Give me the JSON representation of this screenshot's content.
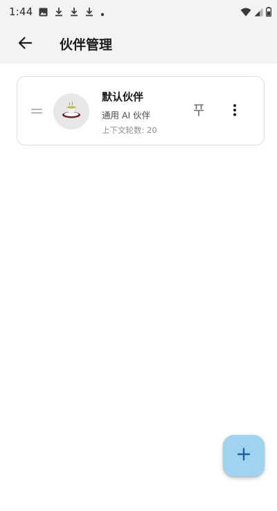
{
  "status_bar": {
    "time": "1:44",
    "left_icons": [
      "image-icon",
      "download-icon",
      "download-icon",
      "download-icon",
      "dot-icon"
    ],
    "right_icons": [
      "wifi-icon",
      "signal-icon",
      "battery-icon"
    ]
  },
  "app_bar": {
    "back_icon": "arrow-left-icon",
    "title": "伙伴管理"
  },
  "partners": [
    {
      "name": "默认伙伴",
      "description": "通用 AI 伙伴",
      "context": "上下文轮数: 20",
      "avatar_icon": "tea-cup-icon",
      "pin_icon": "pin-icon",
      "more_icon": "more-vert-icon"
    }
  ],
  "fab": {
    "icon": "plus-icon"
  },
  "colors": {
    "app_bar_bg": "#f3f3f5",
    "fab_bg": "#9fd3ef",
    "fab_icon": "#1e5ea8",
    "card_border": "#dedee2"
  }
}
